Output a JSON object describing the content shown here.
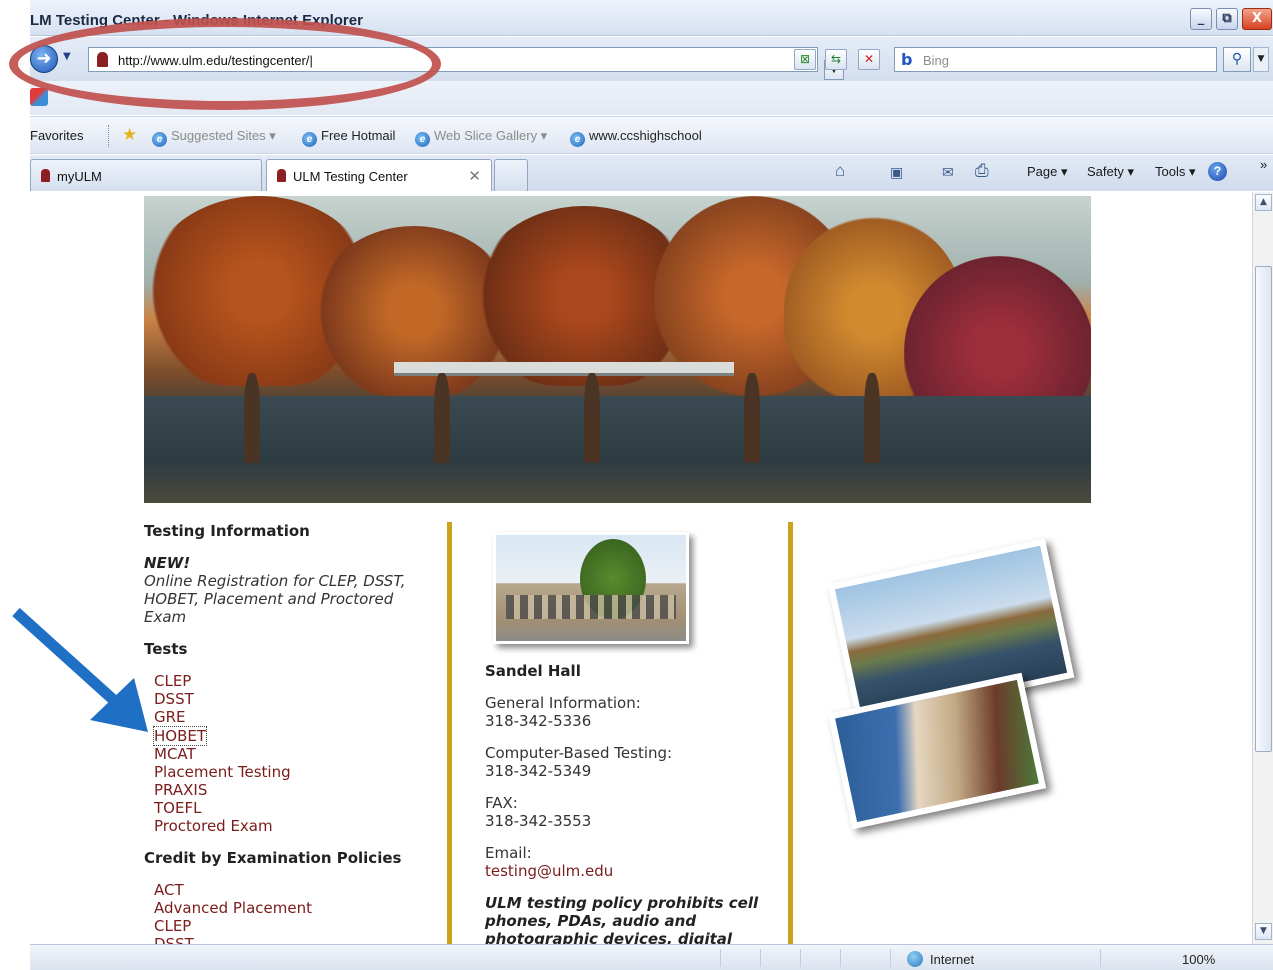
{
  "window": {
    "title": "LM Testing Center - Windows Internet Explorer",
    "minimize_glyph": "_",
    "maximize_glyph": "⧉",
    "close_glyph": "X"
  },
  "address": {
    "url": "http://www.ulm.edu/testingcenter/|",
    "search_placeholder": "Bing",
    "icons": [
      "back-icon",
      "compatibility-icon",
      "refresh-icon",
      "stop-icon",
      "search-icon"
    ]
  },
  "favorites": {
    "label": "Favorites",
    "items": [
      {
        "label": "Suggested Sites ▾",
        "muted": true
      },
      {
        "label": "Free Hotmail",
        "muted": false
      },
      {
        "label": "Web Slice Gallery ▾",
        "muted": true
      },
      {
        "label": "www.ccshighschool",
        "muted": false
      }
    ]
  },
  "tabs": [
    {
      "label": "myULM",
      "active": false
    },
    {
      "label": "ULM Testing Center",
      "active": true
    }
  ],
  "command_bar": {
    "page": "Page ▾",
    "safety": "Safety ▾",
    "tools": "Tools ▾",
    "overflow": "»"
  },
  "page": {
    "testing_info_heading": "Testing Information",
    "new_label": "NEW!",
    "new_text": "Online Registration for CLEP, DSST, HOBET, Placement and Proctored Exam",
    "tests_heading": "Tests",
    "tests": [
      "CLEP",
      "DSST",
      "GRE",
      "HOBET",
      "MCAT",
      "Placement Testing",
      "PRAXIS",
      "TOEFL",
      "Proctored Exam"
    ],
    "credit_heading": "Credit by Examination Policies",
    "credit_links": [
      "ACT",
      "Advanced Placement",
      "CLEP",
      "DSST"
    ],
    "building_name": "Sandel Hall",
    "general_label": "General Information:",
    "general_phone": "318-342-5336",
    "cbt_label": "Computer-Based Testing:",
    "cbt_phone": "318-342-5349",
    "fax_label": "FAX:",
    "fax_phone": "318-342-3553",
    "email_label": "Email:",
    "email": "testing@ulm.edu",
    "policy_text": "ULM testing policy prohibits cell phones, PDAs, audio and photographic devices, digital"
  },
  "status": {
    "zone": "Internet",
    "zoom": "100%"
  },
  "colors": {
    "link": "#7a1c1c",
    "divider": "#c9a11b",
    "annotation_ellipse": "#c0504d",
    "annotation_arrow": "#1f6fc5"
  }
}
